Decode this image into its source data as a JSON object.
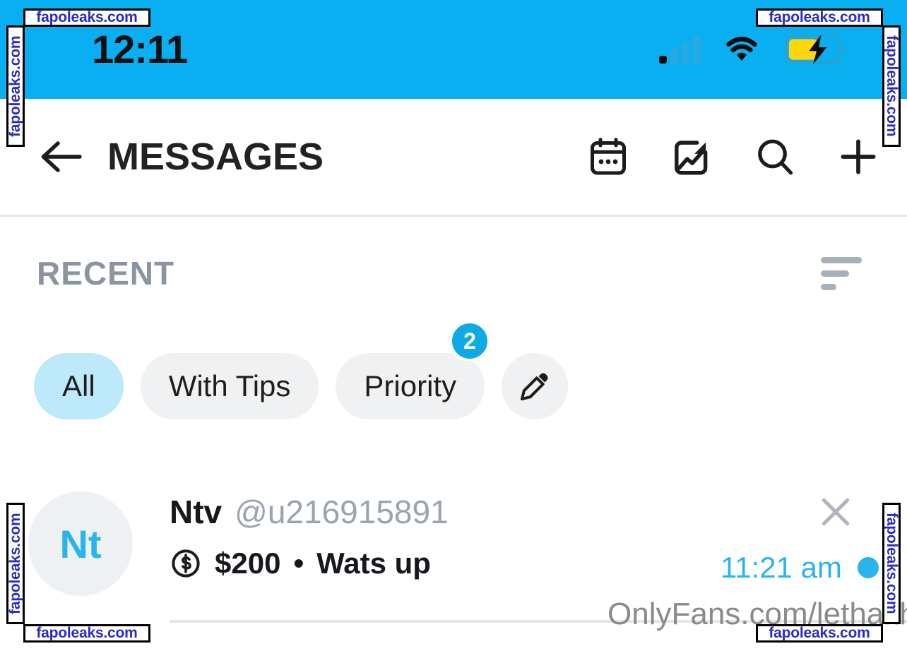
{
  "status_bar": {
    "time": "12:11",
    "icons": [
      "signal-icon",
      "wifi-icon",
      "battery-charging-icon"
    ],
    "background_color": "#09aff0"
  },
  "header": {
    "back_icon": "arrow-left-icon",
    "title": "MESSAGES",
    "actions": [
      {
        "name": "calendar-icon",
        "label": "Calendar"
      },
      {
        "name": "media-stats-icon",
        "label": "Media"
      },
      {
        "name": "search-icon",
        "label": "Search"
      },
      {
        "name": "plus-icon",
        "label": "New"
      }
    ]
  },
  "list_header": {
    "label": "RECENT",
    "sort_icon": "sort-icon"
  },
  "filters": {
    "chips": [
      {
        "label": "All",
        "selected": true,
        "badge": null
      },
      {
        "label": "With Tips",
        "selected": false,
        "badge": null
      },
      {
        "label": "Priority",
        "selected": false,
        "badge": "2"
      }
    ],
    "edit_chip_icon": "pencil-icon"
  },
  "conversations": [
    {
      "avatar_initials": "Nt",
      "name": "Ntv",
      "handle": "@u216915891",
      "amount": "$200",
      "separator": "•",
      "preview": "Wats up",
      "money_icon": "dollar-circle-icon",
      "time": "11:21 am",
      "unread": true,
      "close_icon": "close-icon"
    }
  ],
  "overlay": {
    "onlyfans_url": "OnlyFans.com/lethalthro",
    "watermark_text": "fapoleaks.com"
  },
  "colors": {
    "accent_blue": "#2ab4ee",
    "status_blue": "#09aff0",
    "chip_selected": "#bde9fa",
    "chip_default": "#eff1f2",
    "muted_text": "#8b95a1",
    "watermark_blue": "#2b2bc4"
  }
}
